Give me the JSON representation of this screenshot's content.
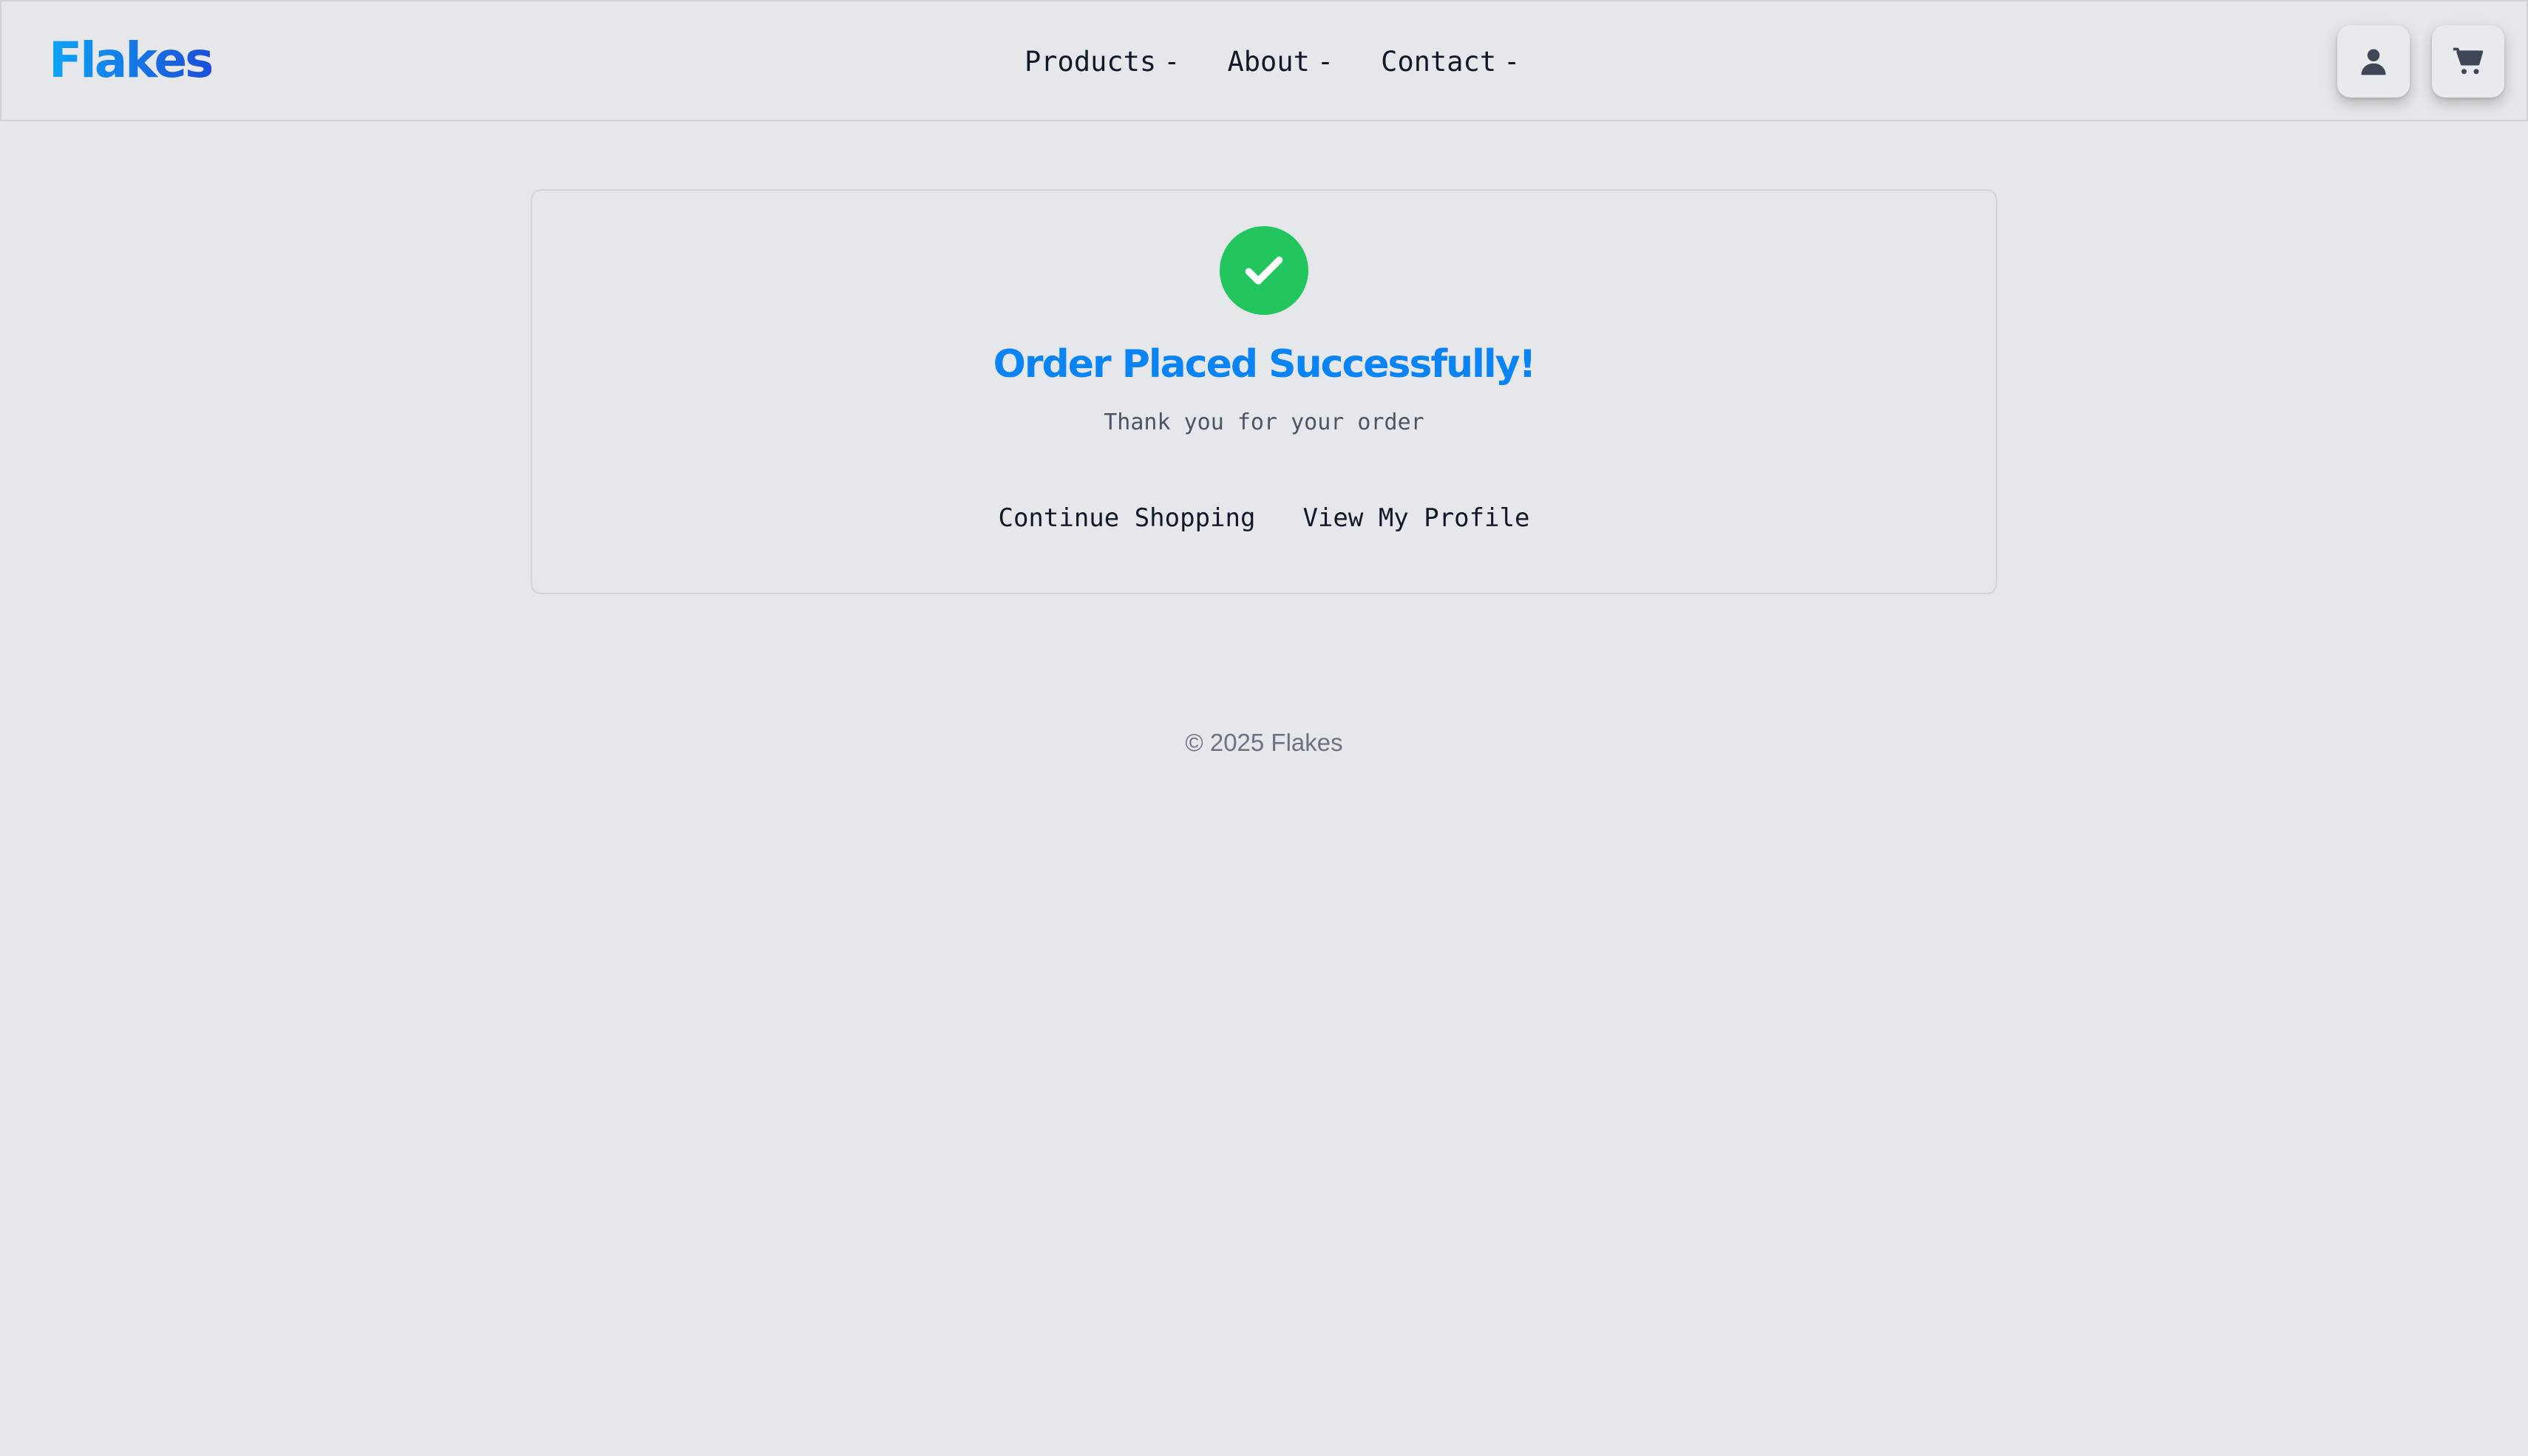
{
  "header": {
    "logo": "Flakes",
    "nav": [
      {
        "label": "Products",
        "caret": "-"
      },
      {
        "label": "About",
        "caret": "-"
      },
      {
        "label": "Contact",
        "caret": "-"
      }
    ],
    "icons": {
      "user": "user-icon",
      "cart": "cart-icon"
    }
  },
  "confirmation": {
    "icon": "check-circle-icon",
    "title": "Order Placed Successfully!",
    "subtitle": "Thank you for your order",
    "continue_label": "Continue Shopping",
    "profile_label": "View My Profile"
  },
  "footer": {
    "copyright": "© 2025 Flakes"
  },
  "colors": {
    "background": "#e5e7eb",
    "brand_gradient_start": "#0ea5f5",
    "brand_gradient_end": "#1d4ed8",
    "success": "#22c55e",
    "title": "#0a84f5"
  }
}
